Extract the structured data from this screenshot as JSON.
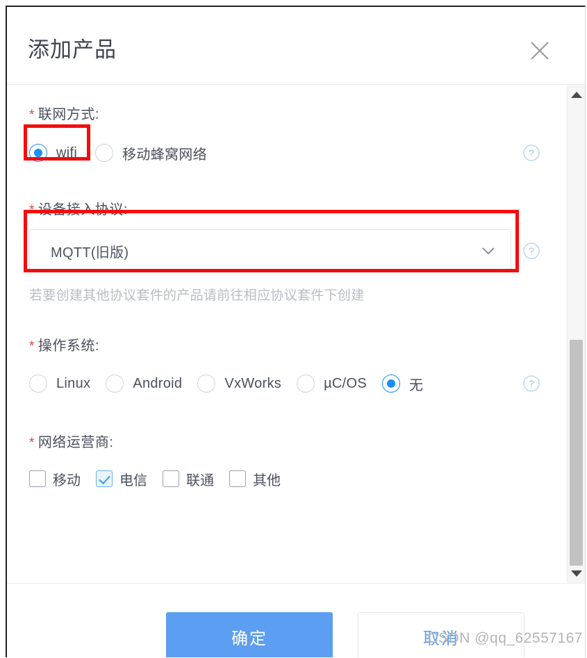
{
  "dialog": {
    "title": "添加产品",
    "close_icon": "close-icon"
  },
  "fields": {
    "network_mode": {
      "label": "联网方式:",
      "required_mark": "*",
      "help_icon": "question-circle-icon",
      "options": [
        {
          "label": "wifi",
          "selected": true
        },
        {
          "label": "移动蜂窝网络",
          "selected": false
        }
      ]
    },
    "device_protocol": {
      "label": "设备接入协议:",
      "required_mark": "*",
      "help_icon": "question-circle-icon",
      "selected_value": "MQTT(旧版)",
      "dropdown_icon": "chevron-down-icon",
      "hint": "若要创建其他协议套件的产品请前往相应协议套件下创建"
    },
    "operating_system": {
      "label": "操作系统:",
      "required_mark": "*",
      "help_icon": "question-circle-icon",
      "options": [
        {
          "label": "Linux",
          "selected": false
        },
        {
          "label": "Android",
          "selected": false
        },
        {
          "label": "VxWorks",
          "selected": false
        },
        {
          "label": "µC/OS",
          "selected": false
        },
        {
          "label": "无",
          "selected": true
        }
      ]
    },
    "network_operator": {
      "label": "网络运营商:",
      "required_mark": "*",
      "options": [
        {
          "label": "移动",
          "checked": false
        },
        {
          "label": "电信",
          "checked": true
        },
        {
          "label": "联通",
          "checked": false
        },
        {
          "label": "其他",
          "checked": false
        }
      ]
    }
  },
  "footer": {
    "confirm_label": "确定",
    "cancel_label": "取消"
  },
  "scrollbar": {
    "up_icon": "caret-up-icon",
    "down_icon": "caret-down-icon"
  },
  "watermark": "CSDN @qq_62557167",
  "colors": {
    "accent": "#1890ff",
    "primary_button": "#5c9ef2",
    "required_star": "#e8413a",
    "annotation": "#f40c0c",
    "label_text": "#4a4f5c",
    "hint_text": "#b9bdc4"
  }
}
